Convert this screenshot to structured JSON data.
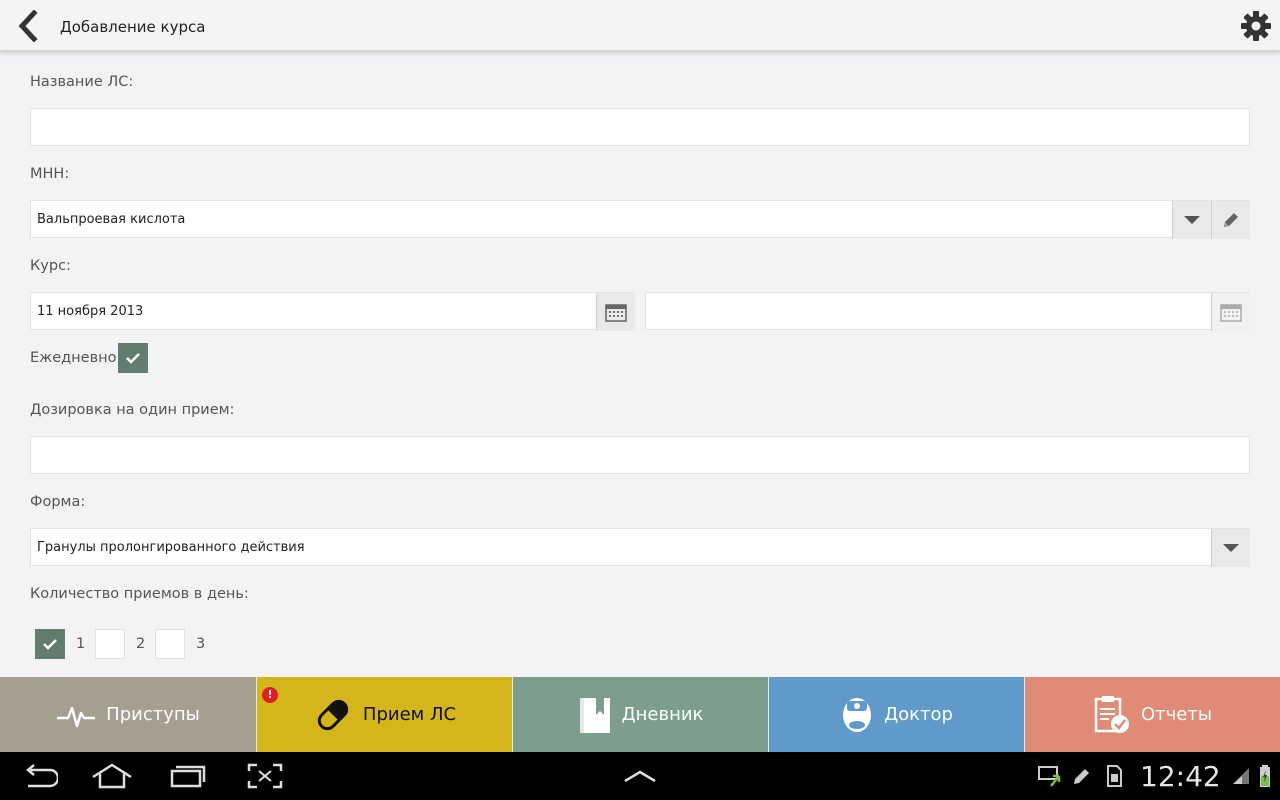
{
  "header": {
    "title": "Добавление курса"
  },
  "form": {
    "drug_name": {
      "label": "Название ЛС:",
      "value": ""
    },
    "inn": {
      "label": "МНН:",
      "value": "Вальпроевая кислота"
    },
    "course": {
      "label": "Курс:",
      "start_value": "11 ноября 2013",
      "end_value": ""
    },
    "daily": {
      "label": "Ежедневно",
      "checked": true
    },
    "dosage": {
      "label": "Дозировка на один прием:",
      "value": ""
    },
    "form_type": {
      "label": "Форма:",
      "value": "Гранулы пролонгированного действия"
    },
    "times_per_day": {
      "label": "Количество приемов в день:",
      "options": [
        {
          "label": "1",
          "checked": true
        },
        {
          "label": "2",
          "checked": false
        },
        {
          "label": "3",
          "checked": false
        }
      ]
    }
  },
  "tabs": [
    {
      "label": "Приступы",
      "icon": "heartbeat-icon",
      "color": "#a69e8f"
    },
    {
      "label": "Прием ЛС",
      "icon": "pill-icon",
      "color": "#d4b51a",
      "badge": "!"
    },
    {
      "label": "Дневник",
      "icon": "book-icon",
      "color": "#7d9e8f"
    },
    {
      "label": "Доктор",
      "icon": "doctor-icon",
      "color": "#5f9acb"
    },
    {
      "label": "Отчеты",
      "icon": "report-icon",
      "color": "#e08b75"
    }
  ],
  "system_bar": {
    "time": "12:42"
  }
}
